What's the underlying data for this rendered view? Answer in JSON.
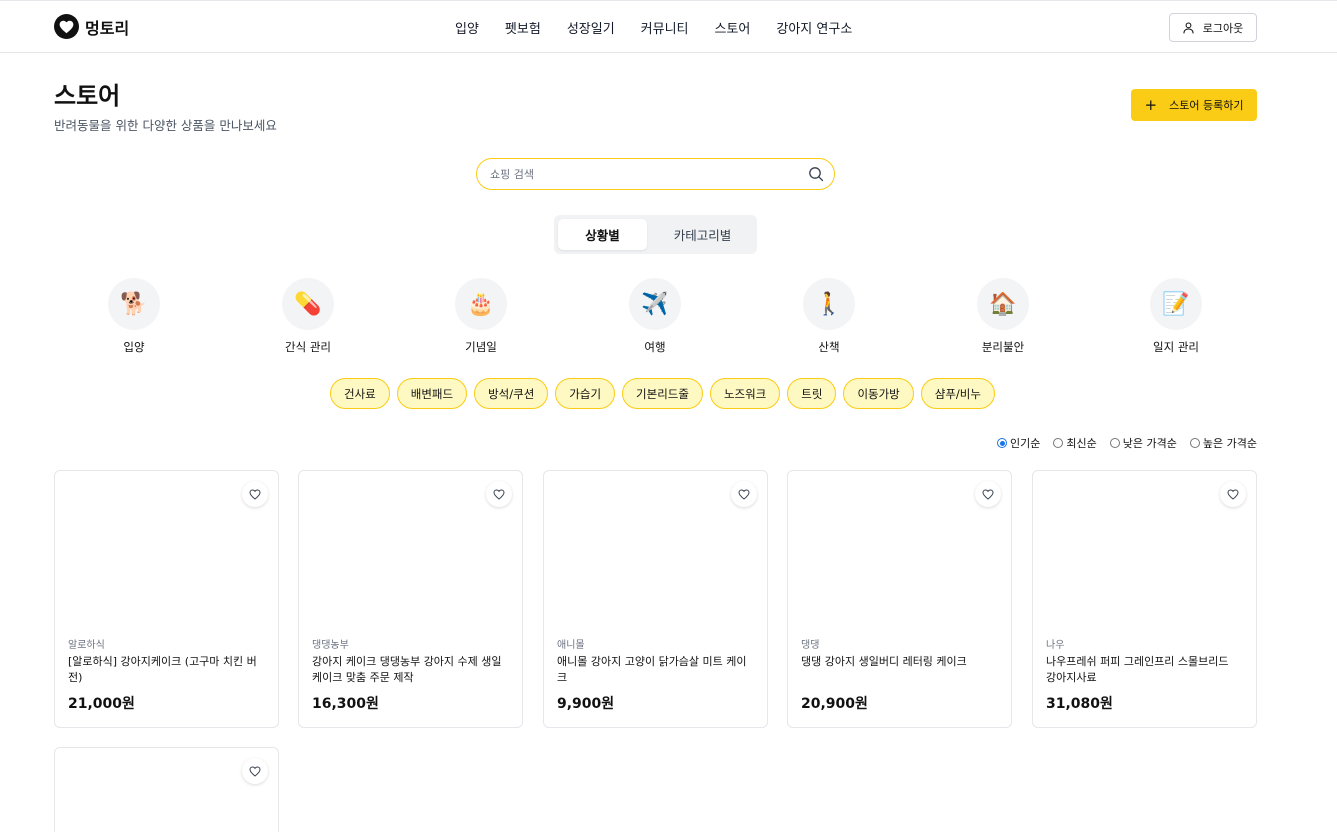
{
  "header": {
    "logo_text": "멍토리",
    "nav": [
      "입양",
      "펫보험",
      "성장일기",
      "커뮤니티",
      "스토어",
      "강아지 연구소"
    ],
    "logout_label": "로그아웃"
  },
  "page": {
    "title": "스토어",
    "subtitle": "반려동물을 위한 다양한 상품을 만나보세요",
    "register_label": "스토어 등록하기"
  },
  "search": {
    "placeholder": "쇼핑 검색",
    "value": ""
  },
  "segment": {
    "active": "상황별",
    "inactive": "카테고리별"
  },
  "situations": [
    {
      "label": "입양",
      "icon": "dog-icon",
      "emoji": "🐕"
    },
    {
      "label": "간식 관리",
      "icon": "pill-icon",
      "emoji": "💊"
    },
    {
      "label": "기념일",
      "icon": "cake-icon",
      "emoji": "🎂"
    },
    {
      "label": "여행",
      "icon": "airplane-icon",
      "emoji": "✈️"
    },
    {
      "label": "산책",
      "icon": "walking-person-icon",
      "emoji": "🚶"
    },
    {
      "label": "분리불안",
      "icon": "house-icon",
      "emoji": "🏠"
    },
    {
      "label": "일지 관리",
      "icon": "memo-icon",
      "emoji": "📝"
    }
  ],
  "chips": [
    "건사료",
    "배변패드",
    "방석/쿠션",
    "가습기",
    "기본리드줄",
    "노즈워크",
    "트릿",
    "이동가방",
    "샴푸/비누"
  ],
  "sort": {
    "options": [
      "인기순",
      "최신순",
      "낮은 가격순",
      "높은 가격순"
    ],
    "selected": "인기순"
  },
  "products": [
    {
      "brand": "알로하식",
      "name": "[알로하식] 강아지케이크 (고구마 치킨 버전)",
      "price": "21,000원"
    },
    {
      "brand": "댕댕농부",
      "name": "강아지 케이크 댕댕농부 강아지 수제 생일 케이크 맞춤 주문 제작",
      "price": "16,300원"
    },
    {
      "brand": "애니몰",
      "name": "애니몰 강아지 고양이 닭가슴살 미트 케이크",
      "price": "9,900원"
    },
    {
      "brand": "댕댕",
      "name": "댕댕 강아지 생일버디 레터링 케이크",
      "price": "20,900원"
    },
    {
      "brand": "나우",
      "name": "나우프레쉬 퍼피 그레인프리 스몰브리드 강아지사료",
      "price": "31,080원"
    },
    {
      "brand": "",
      "name": "",
      "price": ""
    }
  ],
  "colors": {
    "accent": "#facc15",
    "chip_bg": "#fef9c3",
    "radio": "#1a73e8"
  }
}
